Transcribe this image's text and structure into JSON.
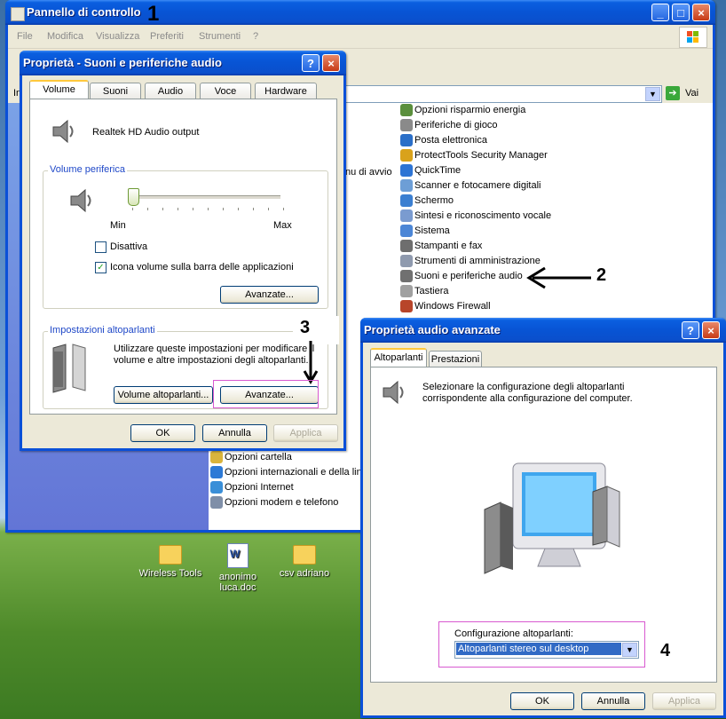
{
  "control_panel": {
    "title": "Pannello di controllo",
    "menu": [
      "File",
      "Modifica",
      "Visualizza",
      "Preferiti",
      "Strumenti",
      "?"
    ],
    "go_label": "Vai",
    "address_fragment": "In",
    "partial_item": "nu di avvio",
    "items_right": [
      "Opzioni risparmio energia",
      "Periferiche di gioco",
      "Posta elettronica",
      "ProtectTools Security Manager",
      "QuickTime",
      "Scanner e fotocamere digitali",
      "Schermo",
      "Sintesi e riconoscimento vocale",
      "Sistema",
      "Stampanti e fax",
      "Strumenti di amministrazione",
      "Suoni e periferiche audio",
      "Tastiera",
      "Windows Firewall"
    ],
    "items_left": [
      "Opzioni cartella",
      "Opzioni internazionali e della ling",
      "Opzioni Internet",
      "Opzioni modem e telefono"
    ]
  },
  "sound_dialog": {
    "title": "Proprietà - Suoni e periferiche audio",
    "tabs": [
      "Volume",
      "Suoni",
      "Audio",
      "Voce",
      "Hardware"
    ],
    "device": "Realtek HD Audio output",
    "volume_group": "Volume periferica",
    "min": "Min",
    "max": "Max",
    "volume_level": 0.0,
    "mute": "Disattiva",
    "mute_checked": false,
    "taskbar_icon": "Icona volume sulla barra delle applicazioni",
    "taskbar_checked": true,
    "advanced": "Avanzate...",
    "speakers_group": "Impostazioni altoparlanti",
    "speakers_desc_1": "Utilizzare queste impostazioni per modificare il",
    "speakers_desc_2": "volume e altre impostazioni degli altoparlanti.",
    "speaker_volume": "Volume altoparlanti...",
    "advanced2": "Avanzate...",
    "ok": "OK",
    "cancel": "Annulla",
    "apply": "Applica"
  },
  "advanced_dialog": {
    "title": "Proprietà audio avanzate",
    "tabs": [
      "Altoparlanti",
      "Prestazioni"
    ],
    "desc_1": "Selezionare la configurazione degli altoparlanti",
    "desc_2": "corrispondente alla configurazione del computer.",
    "config_label": "Configurazione altoparlanti:",
    "config_value": "Altoparlanti stereo sul desktop",
    "ok": "OK",
    "cancel": "Annulla",
    "apply": "Applica"
  },
  "desktop": {
    "icons": [
      {
        "label": "Wireless Tools",
        "type": "folder"
      },
      {
        "label": "anonimo luca.doc",
        "type": "doc"
      },
      {
        "label": "csv adriano",
        "type": "folder"
      }
    ]
  },
  "annotations": [
    "1",
    "2",
    "3",
    "4"
  ],
  "colors": {
    "titlebar": "#0a5fe0",
    "highlight": "#d85ad0",
    "selection": "#316ac5"
  }
}
